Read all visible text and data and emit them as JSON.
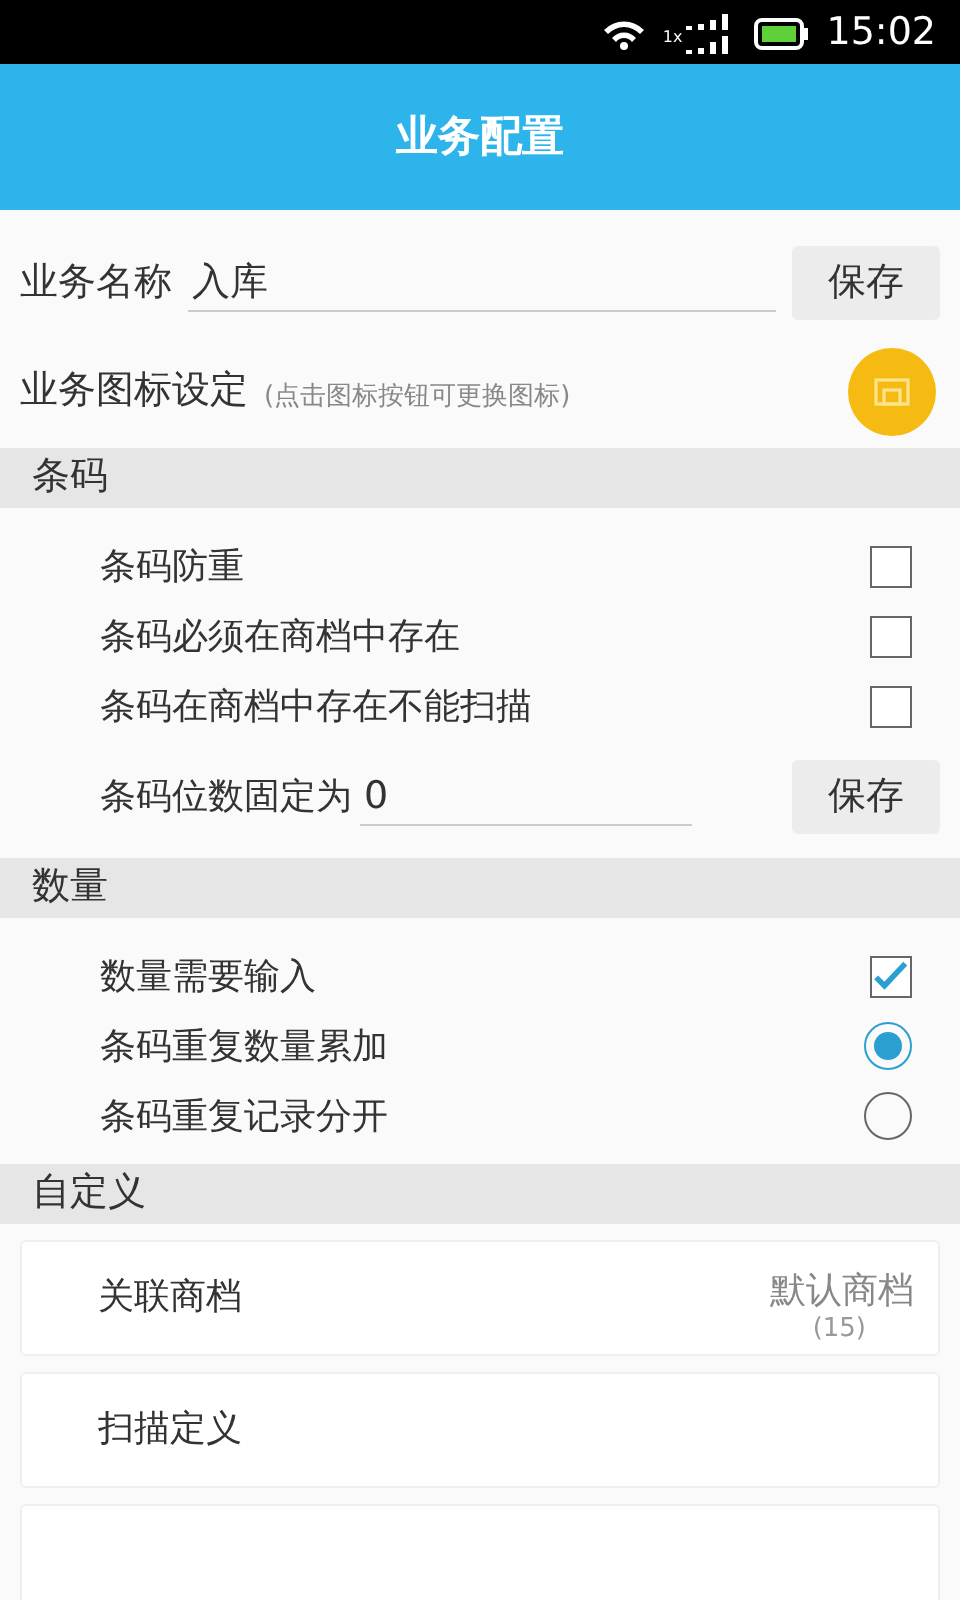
{
  "status_bar": {
    "network": "1x",
    "time": "15:02"
  },
  "header": {
    "title": "业务配置"
  },
  "name_row": {
    "label": "业务名称",
    "value": "入库",
    "button": "保存"
  },
  "icon_row": {
    "label": "业务图标设定",
    "hint": "(点击图标按钮可更换图标)"
  },
  "sections": [
    {
      "title": "条码",
      "items": [
        {
          "kind": "checkbox",
          "label": "条码防重",
          "checked": false
        },
        {
          "kind": "checkbox",
          "label": "条码必须在商档中存在",
          "checked": false
        },
        {
          "kind": "checkbox",
          "label": "条码在商档中存在不能扫描",
          "checked": false
        },
        {
          "kind": "field",
          "label": "条码位数固定为",
          "value": "0",
          "button": "保存"
        }
      ]
    },
    {
      "title": "数量",
      "items": [
        {
          "kind": "checkbox",
          "label": "数量需要输入",
          "checked": true
        },
        {
          "kind": "radio",
          "label": "条码重复数量累加",
          "selected": true
        },
        {
          "kind": "radio",
          "label": "条码重复记录分开",
          "selected": false
        }
      ]
    },
    {
      "title": "自定义",
      "items": [
        {
          "kind": "card",
          "label": "关联商档",
          "value": "默认商档",
          "count": "(15)"
        },
        {
          "kind": "card",
          "label": "扫描定义"
        },
        {
          "kind": "card"
        }
      ]
    }
  ]
}
